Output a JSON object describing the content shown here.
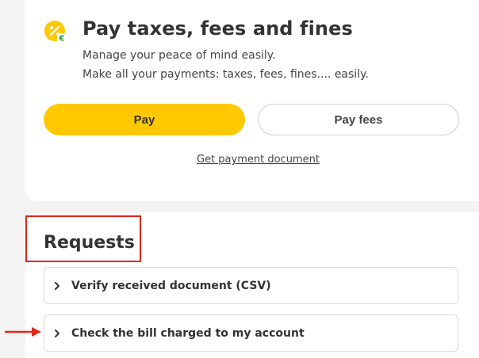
{
  "pay_section": {
    "title": "Pay taxes, fees and fines",
    "description_line1": "Manage your peace of mind easily.",
    "description_line2": "Make all your payments: taxes, fees, fines.... easily.",
    "pay_button": "Pay",
    "pay_fees_button": "Pay fees",
    "payment_document_link": "Get payment document",
    "icon": "percent-euro-icon"
  },
  "requests_section": {
    "title": "Requests",
    "items": [
      {
        "label": "Verify received document (CSV)",
        "icon": "chevron-right-icon"
      },
      {
        "label": "Check the bill charged to my account",
        "icon": "chevron-right-icon"
      }
    ]
  },
  "annotations": {
    "highlight_color": "#e1261c",
    "arrow_color": "#e1261c"
  },
  "colors": {
    "accent": "#ffc800",
    "euro_badge": "#2a9d3a",
    "background": "#f3f3f3"
  }
}
